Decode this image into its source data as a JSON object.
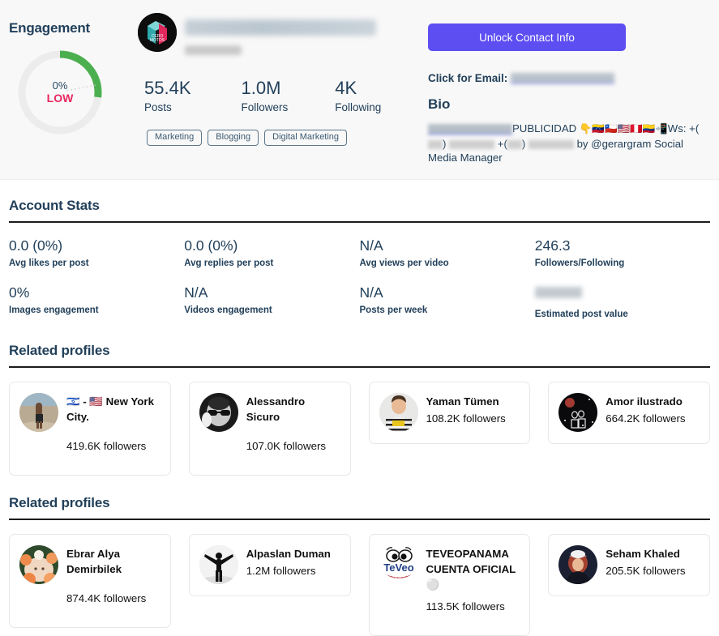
{
  "engagement": {
    "title": "Engagement",
    "percent_label": "0%",
    "level_label": "LOW",
    "arc_fraction": 0.27,
    "arc_color": "#4caf4f",
    "track_color": "#ececed",
    "level_color": "#e8275f"
  },
  "profile": {
    "name_redacted": true,
    "handle_redacted": true,
    "stats": [
      {
        "value": "55.4K",
        "label": "Posts"
      },
      {
        "value": "1.0M",
        "label": "Followers"
      },
      {
        "value": "4K",
        "label": "Following"
      }
    ],
    "tags": [
      "Marketing",
      "Blogging",
      "Digital Marketing"
    ]
  },
  "contact": {
    "unlock_button": "Unlock Contact Info",
    "unlock_button_color": "#5d4ef2",
    "email_label": "Click for Email:",
    "email_value_redacted": true,
    "bio_heading": "Bio",
    "bio_text_publicidad": "PUBLICIDAD",
    "bio_flags": "👇🇻🇪🇨🇱🇺🇸🇵🇪🇨🇴📲",
    "bio_ws": "Ws:",
    "bio_plus1": "+(",
    "bio_close1": ")",
    "bio_plus2": "+(",
    "bio_close2": ")",
    "bio_tail": "by @gerargram Social Media Manager"
  },
  "account_stats": {
    "title": "Account Stats",
    "cells": [
      {
        "value": "0.0 (0%)",
        "label": "Avg likes per post",
        "redacted": false
      },
      {
        "value": "0.0 (0%)",
        "label": "Avg replies per post",
        "redacted": false
      },
      {
        "value": "N/A",
        "label": "Avg views per video",
        "redacted": false
      },
      {
        "value": "246.3",
        "label": "Followers/Following",
        "redacted": false
      },
      {
        "value": "0%",
        "label": "Images engagement",
        "redacted": false
      },
      {
        "value": "N/A",
        "label": "Videos engagement",
        "redacted": false
      },
      {
        "value": "N/A",
        "label": "Posts per week",
        "redacted": false
      },
      {
        "value": "",
        "label": "Estimated post value",
        "redacted": true
      }
    ]
  },
  "related_1": {
    "title": "Related profiles",
    "cards": [
      {
        "name": "🇮🇱 - 🇺🇸 New York City.",
        "followers": "419.6K followers",
        "avatar": "beach-photo",
        "avatar_shape": "circle",
        "stacked": true
      },
      {
        "name": "Alessandro Sicuro",
        "followers": "107.0K followers",
        "avatar": "man-glasses-bw",
        "avatar_shape": "circle",
        "stacked": true
      },
      {
        "name": "Yaman Tümen",
        "followers": "108.2K followers",
        "avatar": "boy-striped-shirt",
        "avatar_shape": "circle",
        "stacked": false
      },
      {
        "name": "Amor ilustrado",
        "followers": "664.2K followers",
        "avatar": "couple-space",
        "avatar_shape": "circle",
        "stacked": false
      }
    ]
  },
  "related_2": {
    "title": "Related profiles",
    "cards": [
      {
        "name": "Ebrar Alya Demirbilek",
        "followers": "874.4K followers",
        "avatar": "baby-flowers",
        "avatar_shape": "circle",
        "stacked": true
      },
      {
        "name": "Alpaslan Duman",
        "followers": "1.2M followers",
        "avatar": "man-arms-open",
        "avatar_shape": "circle",
        "stacked": false
      },
      {
        "name": "TEVEOPANAMA CUENTA OFICIAL ⚪",
        "followers": "113.5K followers",
        "avatar": "teveo-logo",
        "avatar_shape": "square",
        "stacked": true
      },
      {
        "name": "Seham Khaled",
        "followers": "205.5K followers",
        "avatar": "woman-cap",
        "avatar_shape": "circle",
        "stacked": false
      }
    ]
  }
}
